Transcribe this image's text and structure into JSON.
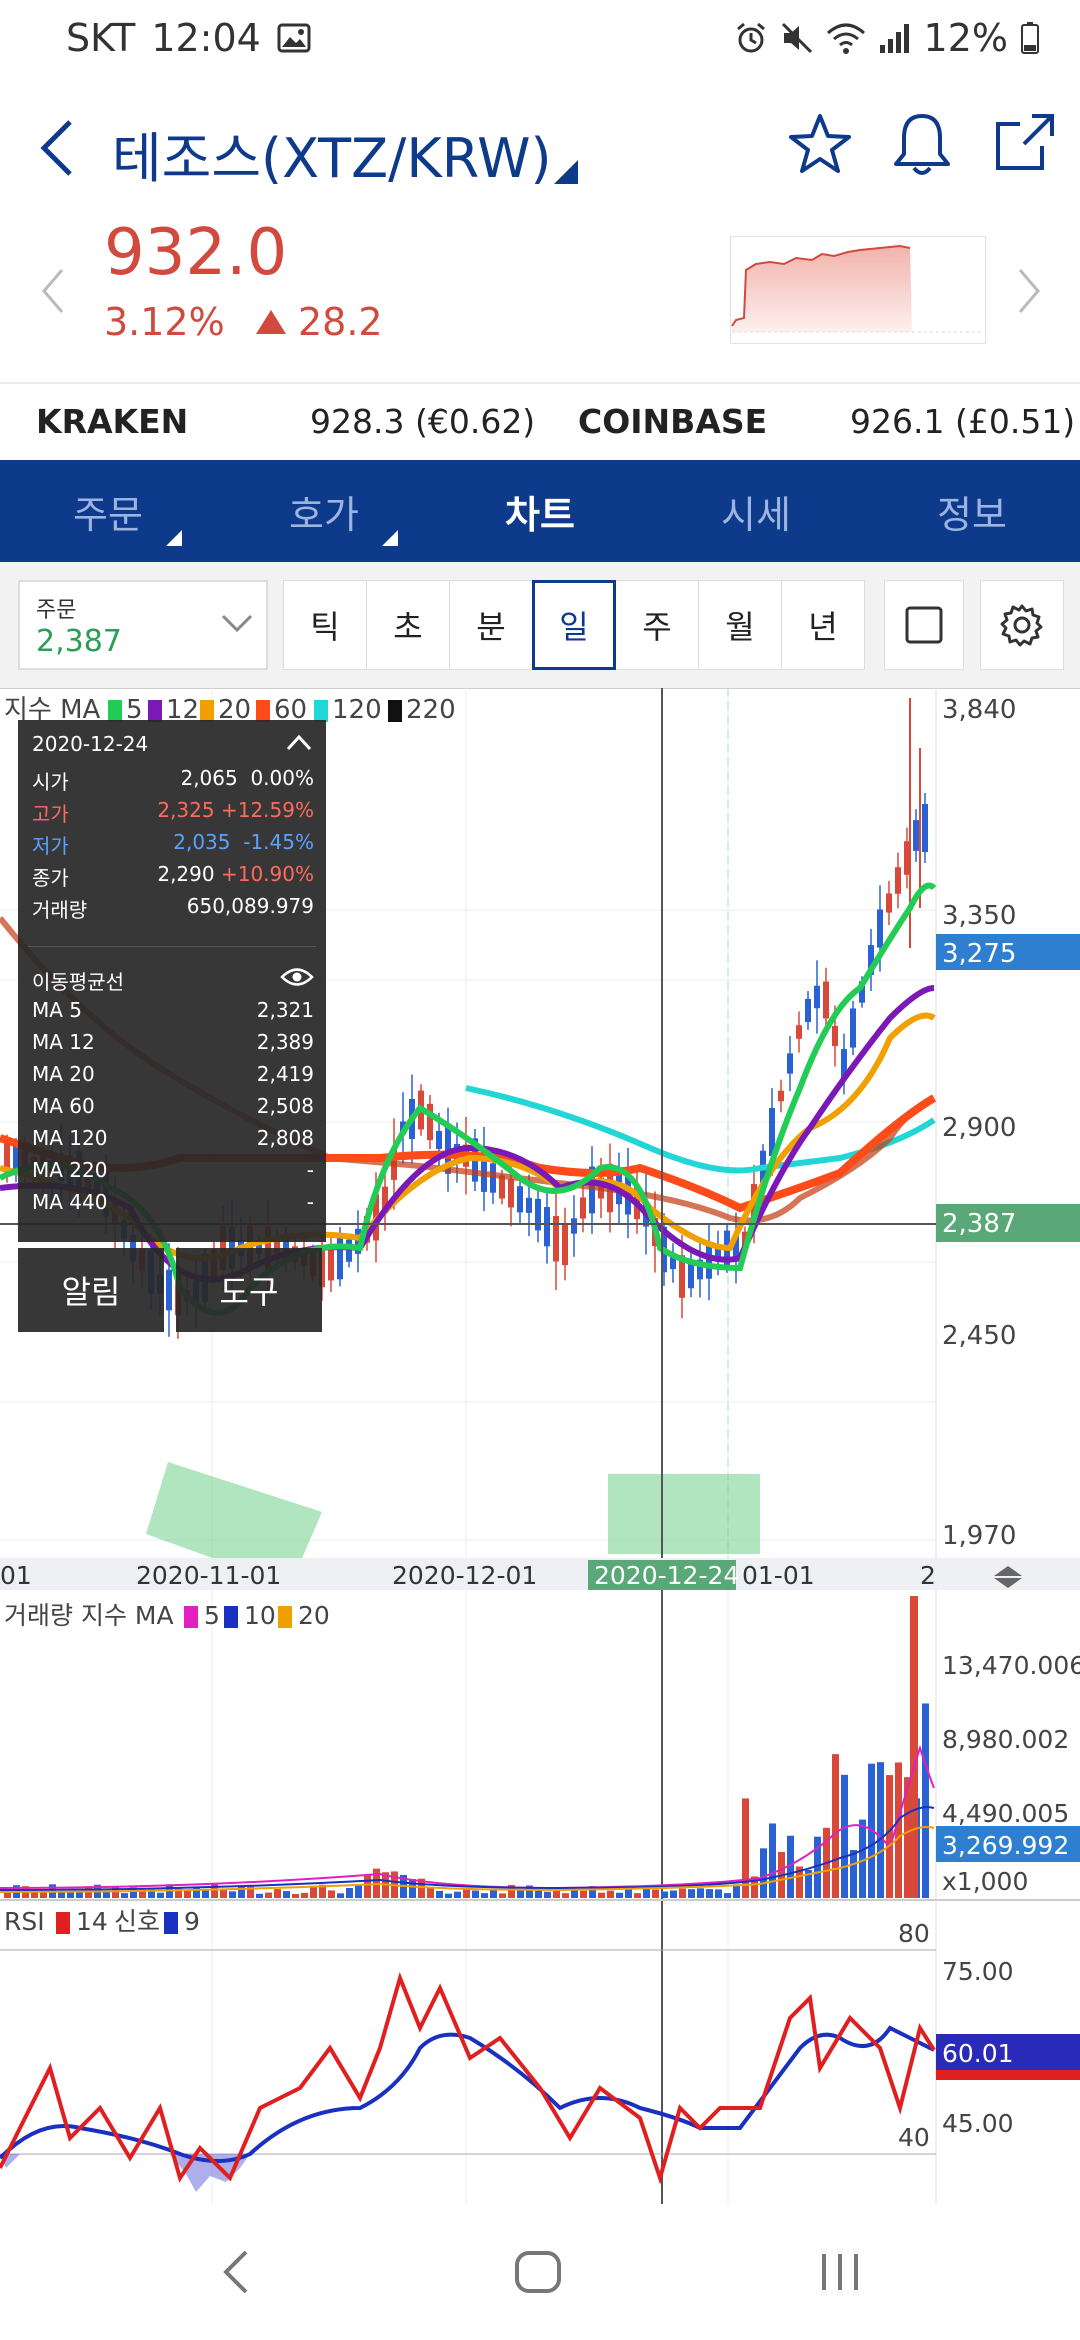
{
  "status_bar": {
    "carrier": "SKT",
    "time": "12:04",
    "battery": "12%"
  },
  "header": {
    "title": "테조스(XTZ/KRW)"
  },
  "price": {
    "current": "932.0",
    "change_pct": "3.12%",
    "change_abs": "28.2"
  },
  "exchanges": [
    {
      "name": "KRAKEN",
      "value": "928.3 (€0.62)"
    },
    {
      "name": "COINBASE",
      "value": "926.1 (£0.51)"
    }
  ],
  "tabs": [
    {
      "label": "주문",
      "caret": true
    },
    {
      "label": "호가",
      "caret": true
    },
    {
      "label": "차트",
      "active": true
    },
    {
      "label": "시세"
    },
    {
      "label": "정보"
    }
  ],
  "order_box": {
    "label": "주문",
    "value": "2,387"
  },
  "periods": [
    "틱",
    "초",
    "분",
    "일",
    "주",
    "월",
    "년"
  ],
  "active_period": "일",
  "price_chart": {
    "legend": {
      "name": "지수 MA",
      "periods": [
        "5",
        "12",
        "20",
        "60",
        "120",
        "220"
      ],
      "colors": [
        "#22cc55",
        "#7a19b5",
        "#f0a000",
        "#ff4a1a",
        "#22d6d6",
        "#111111"
      ]
    },
    "y_ticks": [
      "3,840",
      "3,350",
      "2,900",
      "2,450",
      "1,970"
    ],
    "current_tag": "3,275",
    "crosshair_tag": "2,387",
    "x_ticks": [
      "01",
      "2020-11-01",
      "2020-12-01",
      "01-01",
      "2"
    ],
    "x_highlight": "2020-12-24"
  },
  "info_panel": {
    "date": "2020-12-24",
    "rows": [
      {
        "label": "시가",
        "value": "2,065",
        "pct": "0.00%"
      },
      {
        "label": "고가",
        "value": "2,325",
        "pct": "+12.59%"
      },
      {
        "label": "저가",
        "value": "2,035",
        "pct": "-1.45%"
      },
      {
        "label": "종가",
        "value": "2,290",
        "pct": "+10.90%"
      },
      {
        "label": "거래량",
        "value": "650,089.979"
      }
    ],
    "ma_title": "이동평균선",
    "ma_rows": [
      {
        "label": "MA 5",
        "value": "2,321"
      },
      {
        "label": "MA 12",
        "value": "2,389"
      },
      {
        "label": "MA 20",
        "value": "2,419"
      },
      {
        "label": "MA 60",
        "value": "2,508"
      },
      {
        "label": "MA 120",
        "value": "2,808"
      },
      {
        "label": "MA 220",
        "value": "-"
      },
      {
        "label": "MA 440",
        "value": "-"
      }
    ]
  },
  "buttons": {
    "alarm": "알림",
    "tools": "도구"
  },
  "volume_chart": {
    "legend": {
      "name": "거래량 지수 MA",
      "periods": [
        "5",
        "10",
        "20"
      ],
      "colors": [
        "#e020c0",
        "#1a30c0",
        "#f0a000"
      ]
    },
    "y_ticks": [
      "13,470.006",
      "8,980.002",
      "4,490.005"
    ],
    "current_tag": "3,269.992",
    "unit": "x1,000"
  },
  "rsi_chart": {
    "legend": {
      "name": "RSI",
      "period": "14",
      "signal_name": "신호",
      "signal_period": "9"
    },
    "y_ticks": [
      "75.00",
      "45.00"
    ],
    "level_high": "80",
    "level_low": "40",
    "current_tag": "60.01"
  }
}
